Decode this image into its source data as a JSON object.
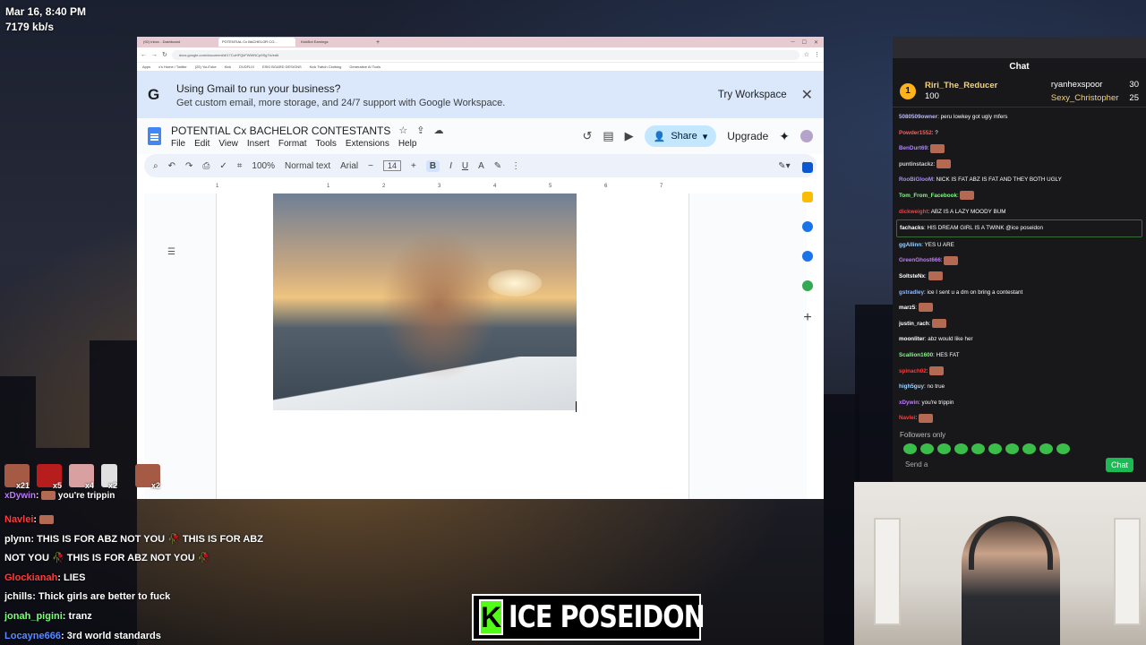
{
  "stream": {
    "datetime": "Mar 16, 8:40 PM",
    "bitrate": "7179 kb/s"
  },
  "browser": {
    "tabs": [
      "(92) Inbox - Dashboard",
      "POTENTIAL Cx BACHELOR CO...",
      "KickBot Earnings"
    ],
    "url": "docs.google.com/document/d/17CuHFQkFWWNCp9Sg7ix/edit",
    "bookmarks": [
      "Apps",
      "x's Home / Twitter",
      "(25) YouTube",
      "Kick",
      "DVDFLIX",
      "ESKI BOARD DESIGNS",
      "Kick Twitch Clothing",
      "Generative AI Tools"
    ]
  },
  "promo": {
    "title": "Using Gmail to run your business?",
    "subtitle": "Get custom email, more storage, and 24/7 support with Google Workspace.",
    "cta": "Try Workspace",
    "close": "✕"
  },
  "doc": {
    "title": "POTENTIAL Cx BACHELOR CONTESTANTS",
    "menus": [
      "File",
      "Edit",
      "View",
      "Insert",
      "Format",
      "Tools",
      "Extensions",
      "Help"
    ],
    "share": "Share",
    "upgrade": "Upgrade",
    "zoom": "100%",
    "style": "Normal text",
    "font": "Arial",
    "font_size": "14",
    "ruler": [
      "1",
      "1",
      "2",
      "3",
      "4",
      "5",
      "6",
      "7"
    ]
  },
  "chat_panel": {
    "title": "Chat",
    "leader_name": "Riri_The_Reducer",
    "leader_rank": "1",
    "leader_score": "100",
    "leaders": [
      {
        "name": "ryanhexspoor",
        "score": "30"
      },
      {
        "name": "Sexy_Christopher",
        "score": "25"
      }
    ],
    "messages": [
      {
        "user": "5080509owner",
        "text": "peru lowkey got ugly mfers",
        "color": "#b9b9ff"
      },
      {
        "user": "Powder1552",
        "text": "?",
        "color": "#ff5b5b"
      },
      {
        "user": "BenDurt69",
        "text": "",
        "color": "#b083ff"
      },
      {
        "user": "puntinstackz",
        "text": "",
        "color": "#cfcfcf"
      },
      {
        "user": "RooBiGlooM",
        "text": "NICK IS FAT ABZ IS FAT AND THEY BOTH UGLY",
        "color": "#a98bff"
      },
      {
        "user": "Tom_From_Facebook",
        "text": "",
        "color": "#7cff7c"
      },
      {
        "user": "dickweight",
        "text": "ABZ IS A LAZY MOODY BUM",
        "color": "#ff3b3b"
      },
      {
        "user": "fachacks",
        "text": "HIS DREAM GIRL IS A TWINK @ice poseidon",
        "color": "#ffffff"
      },
      {
        "user": "ggAllinn",
        "text": "YES U ARE",
        "color": "#9fd4ff"
      },
      {
        "user": "GreenGhost666",
        "text": "",
        "color": "#c07bff"
      },
      {
        "user": "SoltsteNx",
        "text": "",
        "color": "#ffffff"
      },
      {
        "user": "gstradley",
        "text": "ice I sent u a dm on bring a contestant",
        "color": "#8fb8ff"
      },
      {
        "user": "marz5",
        "text": "",
        "color": "#ffffff"
      },
      {
        "user": "justin_rach",
        "text": "",
        "color": "#ffffff"
      },
      {
        "user": "moonliter",
        "text": "abz would like her",
        "color": "#ffffff"
      },
      {
        "user": "Scallion1600",
        "text": "HES FAT",
        "color": "#7cff7c"
      },
      {
        "user": "spinach02",
        "text": "",
        "color": "#ff3b3b"
      },
      {
        "user": "high5guy",
        "text": "no true",
        "color": "#9fd4ff"
      },
      {
        "user": "xDywin",
        "text": "you're trippin",
        "color": "#c07bff"
      },
      {
        "user": "Navlei",
        "text": "",
        "color": "#ff3b3b"
      }
    ],
    "followers": "Followers only",
    "send": "Send a",
    "chat_btn": "Chat"
  },
  "overlay": {
    "emote_counts": [
      "x21",
      "x5",
      "x4",
      "x2",
      "x2"
    ],
    "xdywin_user": "xDywin",
    "xdywin_text": "you're trippin",
    "messages": [
      {
        "user": "Navlei",
        "text": "",
        "color": "#ff3b3b"
      },
      {
        "user": "plynn",
        "text": "THIS IS FOR ABZ NOT YOU 🥀 THIS IS FOR ABZ",
        "color": "#ffffff"
      },
      {
        "user": "",
        "text": "NOT YOU 🥀 THIS IS FOR ABZ NOT YOU 🥀",
        "color": "#ffffff"
      },
      {
        "user": "Glockianah",
        "text": "LIES",
        "color": "#ff3b3b"
      },
      {
        "user": "jchills",
        "text": "Thick girls are better to fuck",
        "color": "#ffffff"
      },
      {
        "user": "jonah_pigini",
        "text": "tranz",
        "color": "#7cff7c"
      },
      {
        "user": "Locayne666",
        "text": "3rd world standards",
        "color": "#5b8bff"
      }
    ],
    "brand": "ICE POSEIDON",
    "brand_k": "K"
  }
}
